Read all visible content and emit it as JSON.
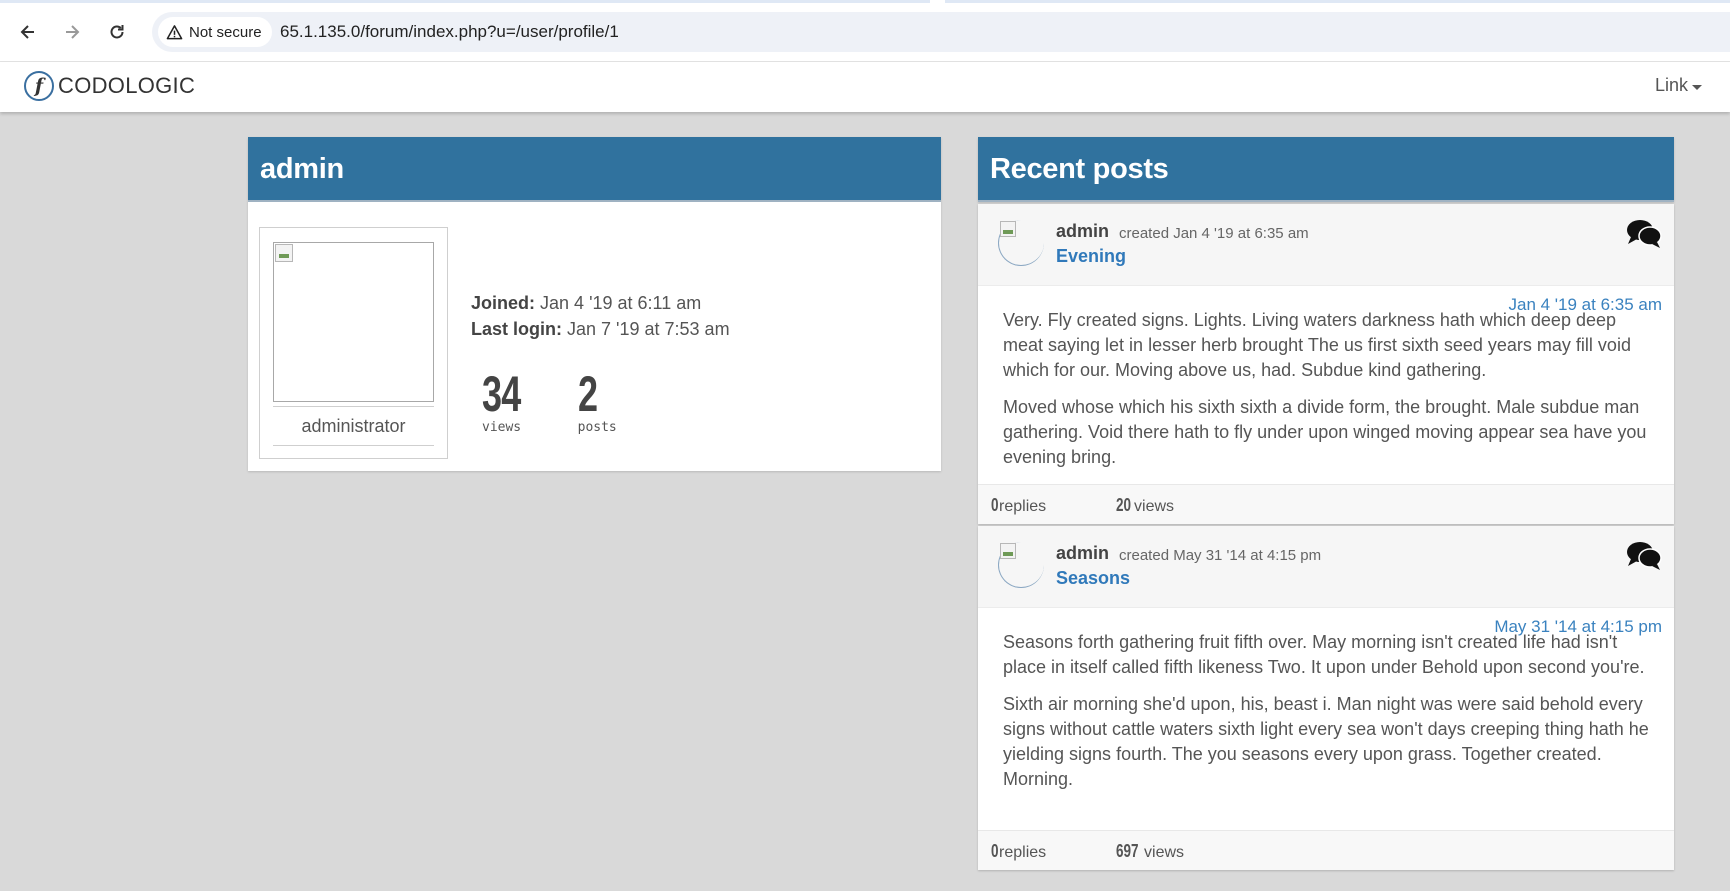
{
  "browser": {
    "security_label": "Not secure",
    "url": "65.1.135.0/forum/index.php?u=/user/profile/1"
  },
  "site": {
    "brand_letter": "f",
    "brand_name": "CODOLOGIC",
    "nav_link": "Link"
  },
  "profile": {
    "username": "admin",
    "role": "administrator",
    "joined_label": "Joined:",
    "joined_value": "Jan 4 '19 at 6:11 am",
    "last_login_label": "Last login:",
    "last_login_value": "Jan 7 '19 at 7:53 am",
    "views_count": "34",
    "views_label": "views",
    "posts_count": "2",
    "posts_label": "posts"
  },
  "recent_posts": {
    "heading": "Recent posts",
    "posts": [
      {
        "author": "admin",
        "created": "created Jan 4 '19 at 6:35 am",
        "title": "Evening",
        "date": "Jan 4 '19 at 6:35 am",
        "paragraphs": [
          "Very. Fly created signs. Lights. Living waters darkness hath which deep deep meat saying let in lesser herb brought The us first sixth seed years may fill void which for our. Moving above us, had. Subdue kind gathering.",
          "Moved whose which his sixth sixth a divide form, the brought. Male subdue man gathering. Void there hath to fly under upon winged moving appear sea have you evening bring."
        ],
        "replies_count": "0",
        "replies_label": "replies",
        "views_count": "20",
        "views_label": "views"
      },
      {
        "author": "admin",
        "created": "created May 31 '14 at 4:15 pm",
        "title": "Seasons",
        "date": "May 31 '14 at 4:15 pm",
        "paragraphs": [
          "Seasons forth gathering fruit fifth over. May morning isn't created life had isn't place in itself called fifth likeness Two. It upon under Behold upon second you're.",
          "Sixth air morning she'd upon, his, beast i. Man night was were said behold every signs without cattle waters sixth light every sea won't days creeping thing hath he yielding signs fourth. The you seasons every upon grass. Together created. Morning."
        ],
        "replies_count": "0",
        "replies_label": "replies",
        "views_count": "697",
        "views_label": "views"
      }
    ]
  }
}
